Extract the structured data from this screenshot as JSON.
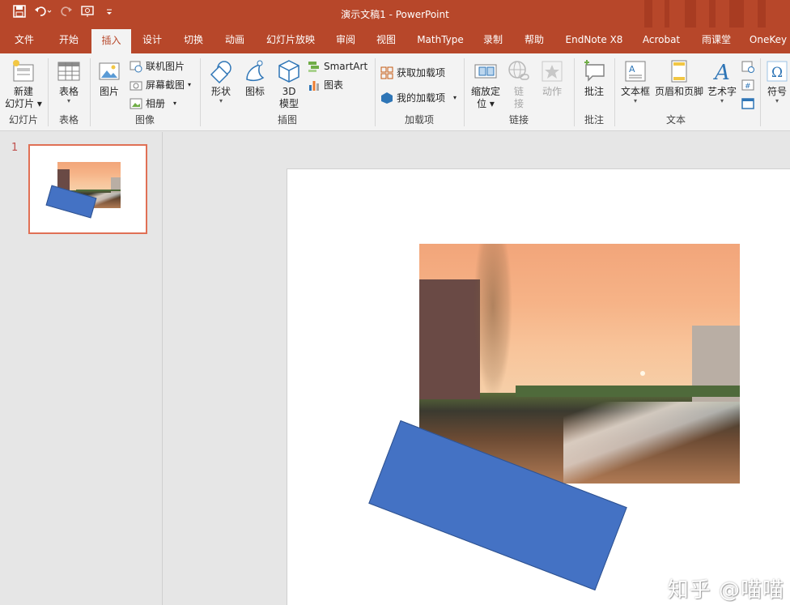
{
  "window": {
    "title": "演示文稿1  -  PowerPoint",
    "accent": "#b7472a"
  },
  "qat": {
    "save_icon": "save-icon",
    "undo_icon": "undo-icon",
    "redo_icon": "redo-icon",
    "present_icon": "start-presentation-icon",
    "customize_icon": "customize-qat-icon"
  },
  "tabs": [
    {
      "label": "文件"
    },
    {
      "label": "开始"
    },
    {
      "label": "插入",
      "active": true
    },
    {
      "label": "设计"
    },
    {
      "label": "切换"
    },
    {
      "label": "动画"
    },
    {
      "label": "幻灯片放映"
    },
    {
      "label": "审阅"
    },
    {
      "label": "视图"
    },
    {
      "label": "MathType"
    },
    {
      "label": "录制"
    },
    {
      "label": "帮助"
    },
    {
      "label": "EndNote X8"
    },
    {
      "label": "Acrobat"
    },
    {
      "label": "雨课堂"
    },
    {
      "label": "OneKey"
    }
  ],
  "ribbon": {
    "slides": {
      "new_slide_line1": "新建",
      "new_slide_line2": "幻灯片",
      "group": "幻灯片"
    },
    "tables": {
      "table": "表格",
      "group": "表格"
    },
    "images": {
      "picture": "图片",
      "online_pictures": "联机图片",
      "screenshot": "屏幕截图",
      "album": "相册",
      "group": "图像"
    },
    "illustrations": {
      "shapes": "形状",
      "icons": "图标",
      "model3d_line1": "3D",
      "model3d_line2": "模型",
      "smartart": "SmartArt",
      "chart": "图表",
      "group": "插图"
    },
    "addins": {
      "get_addins": "获取加载项",
      "my_addins": "我的加载项",
      "group": "加载项"
    },
    "links": {
      "zoom_line1": "缩放定",
      "zoom_line2": "位",
      "link_line1": "链",
      "link_line2": "接",
      "action": "动作",
      "group": "链接"
    },
    "comments": {
      "comment": "批注",
      "group": "批注"
    },
    "text": {
      "textbox": "文本框",
      "header_footer": "页眉和页脚",
      "wordart": "艺术字",
      "group": "文本"
    },
    "symbols": {
      "symbol": "符号"
    }
  },
  "slide_panel": {
    "slide_number": "1"
  },
  "watermark": "知乎 @喵喵",
  "colors": {
    "shape_fill": "#4472c4",
    "thumb_border": "#e07055"
  }
}
